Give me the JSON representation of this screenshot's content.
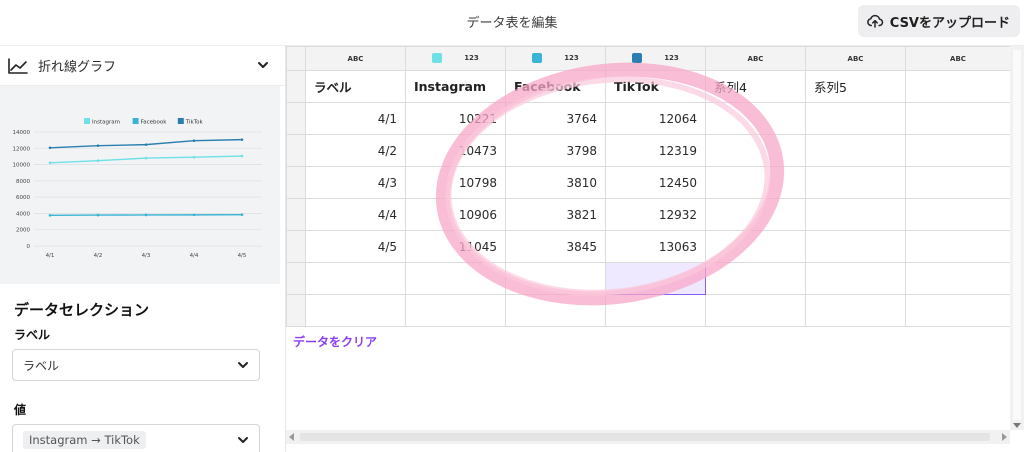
{
  "topbar": {
    "title": "データ表を編集",
    "csv_button": "CSVをアップロード"
  },
  "left": {
    "chart_type": "折れ線グラフ",
    "data_selection_title": "データセレクション",
    "label_title": "ラベル",
    "label_select_value": "ラベル",
    "value_title": "値",
    "value_select_value": "Instagram → TikTok"
  },
  "colors": {
    "instagram": "#6fe0e6",
    "facebook": "#3ab3d4",
    "tiktok": "#2a7fb0",
    "accent": "#8a3ff0"
  },
  "grid": {
    "type_badges": [
      "ABC",
      "123",
      "123",
      "123",
      "ABC",
      "ABC",
      "ABC"
    ],
    "headers": [
      "ラベル",
      "Instagram",
      "Facebook",
      "TikTok",
      "系列4",
      "系列5",
      ""
    ],
    "rows": [
      [
        "4/1",
        "10221",
        "3764",
        "12064"
      ],
      [
        "4/2",
        "10473",
        "3798",
        "12319"
      ],
      [
        "4/3",
        "10798",
        "3810",
        "12450"
      ],
      [
        "4/4",
        "10906",
        "3821",
        "12932"
      ],
      [
        "4/5",
        "11045",
        "3845",
        "13063"
      ]
    ],
    "clear_link": "データをクリア"
  },
  "chart_data": {
    "type": "line",
    "categories": [
      "4/1",
      "4/2",
      "4/3",
      "4/4",
      "4/5"
    ],
    "series": [
      {
        "name": "Instagram",
        "values": [
          10221,
          10473,
          10798,
          10906,
          11045
        ],
        "color": "#6fe0e6"
      },
      {
        "name": "Facebook",
        "values": [
          3764,
          3798,
          3810,
          3821,
          3845
        ],
        "color": "#3ab3d4"
      },
      {
        "name": "TikTok",
        "values": [
          12064,
          12319,
          12450,
          12932,
          13063
        ],
        "color": "#2a7fb0"
      }
    ],
    "y_ticks": [
      "0",
      "2000",
      "4000",
      "6000",
      "8000",
      "10000",
      "12000",
      "14000"
    ],
    "ylim": [
      0,
      14000
    ],
    "legend": "top",
    "grid": true
  }
}
